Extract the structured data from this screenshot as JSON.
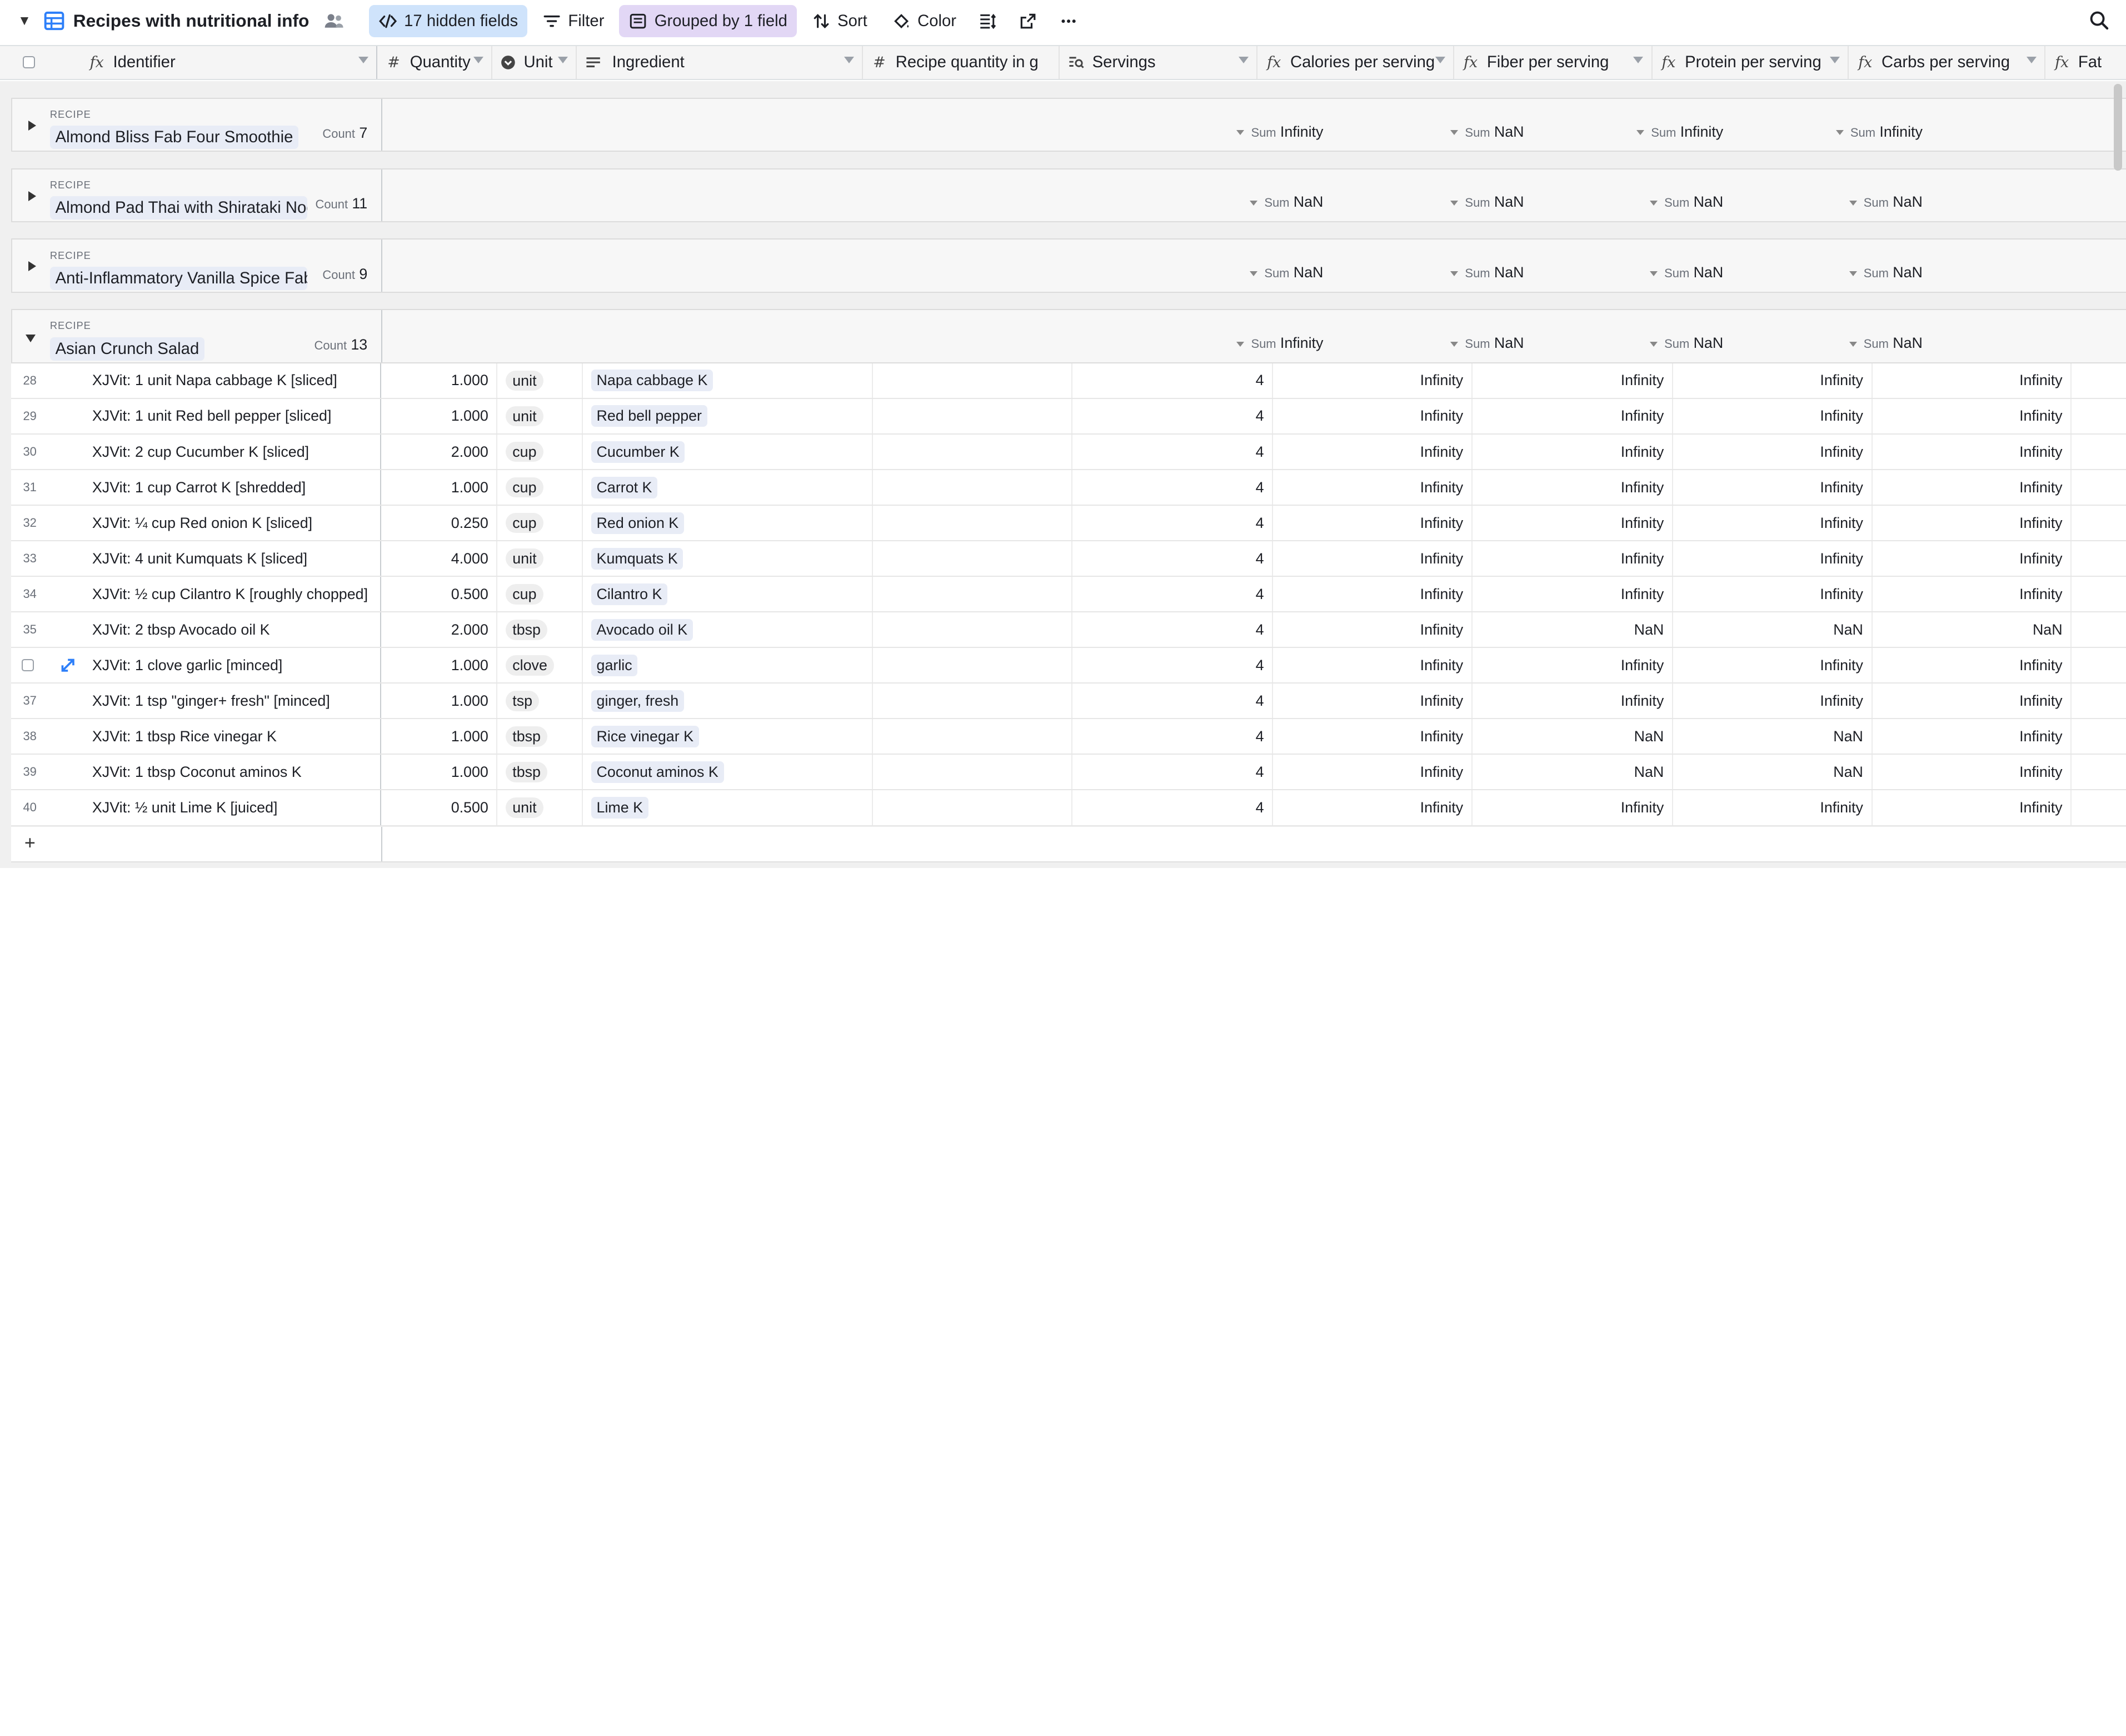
{
  "toolbar": {
    "title": "Recipes with nutritional info",
    "hidden_fields": "17 hidden fields",
    "filter": "Filter",
    "grouped": "Grouped by 1 field",
    "sort": "Sort",
    "color": "Color"
  },
  "columns": [
    {
      "label": "Identifier",
      "icon": "formula-icon"
    },
    {
      "label": "Quantity",
      "icon": "number-icon"
    },
    {
      "label": "Unit",
      "icon": "single-select-icon"
    },
    {
      "label": "Ingredient",
      "icon": "link-icon"
    },
    {
      "label": "Recipe quantity in g",
      "icon": "number-icon"
    },
    {
      "label": "Servings",
      "icon": "lookup-icon"
    },
    {
      "label": "Calories per serving",
      "icon": "formula-icon"
    },
    {
      "label": "Fiber per serving",
      "icon": "formula-icon"
    },
    {
      "label": "Protein per serving",
      "icon": "formula-icon"
    },
    {
      "label": "Carbs per serving",
      "icon": "formula-icon"
    },
    {
      "label": "Fat",
      "icon": "formula-icon"
    }
  ],
  "group_label": "RECIPE",
  "count_label": "Count",
  "sum_label": "Sum",
  "groups": [
    {
      "name": "Almond Bliss Fab Four Smoothie",
      "count": "7",
      "sums": [
        "Infinity",
        "NaN",
        "Infinity",
        "Infinity"
      ],
      "expanded": false
    },
    {
      "name": "Almond Pad Thai with Shirataki Noodles",
      "count": "11",
      "sums": [
        "NaN",
        "NaN",
        "NaN",
        "NaN"
      ],
      "expanded": false
    },
    {
      "name": "Anti-Inflammatory Vanilla Spice Fab Four Smoothie",
      "count": "9",
      "sums": [
        "NaN",
        "NaN",
        "NaN",
        "NaN"
      ],
      "expanded": false
    },
    {
      "name": "Asian Crunch Salad",
      "count": "13",
      "sums": [
        "Infinity",
        "NaN",
        "NaN",
        "NaN"
      ],
      "expanded": true
    }
  ],
  "rows": [
    {
      "num": "28",
      "identifier": "XJVit: 1 unit Napa cabbage K [sliced]",
      "quantity": "1.000",
      "unit": "unit",
      "ingredient": "Napa cabbage K",
      "servings": "4",
      "calories": "Infinity",
      "fiber": "Infinity",
      "protein": "Infinity",
      "carbs": "Infinity"
    },
    {
      "num": "29",
      "identifier": "XJVit: 1 unit Red bell pepper [sliced]",
      "quantity": "1.000",
      "unit": "unit",
      "ingredient": "Red bell pepper",
      "servings": "4",
      "calories": "Infinity",
      "fiber": "Infinity",
      "protein": "Infinity",
      "carbs": "Infinity"
    },
    {
      "num": "30",
      "identifier": "XJVit: 2 cup Cucumber K [sliced]",
      "quantity": "2.000",
      "unit": "cup",
      "ingredient": "Cucumber K",
      "servings": "4",
      "calories": "Infinity",
      "fiber": "Infinity",
      "protein": "Infinity",
      "carbs": "Infinity"
    },
    {
      "num": "31",
      "identifier": "XJVit: 1 cup Carrot K [shredded]",
      "quantity": "1.000",
      "unit": "cup",
      "ingredient": "Carrot K",
      "servings": "4",
      "calories": "Infinity",
      "fiber": "Infinity",
      "protein": "Infinity",
      "carbs": "Infinity"
    },
    {
      "num": "32",
      "identifier": "XJVit: ¼ cup Red onion K [sliced]",
      "quantity": "0.250",
      "unit": "cup",
      "ingredient": "Red onion K",
      "servings": "4",
      "calories": "Infinity",
      "fiber": "Infinity",
      "protein": "Infinity",
      "carbs": "Infinity"
    },
    {
      "num": "33",
      "identifier": "XJVit: 4 unit Kumquats K [sliced]",
      "quantity": "4.000",
      "unit": "unit",
      "ingredient": "Kumquats K",
      "servings": "4",
      "calories": "Infinity",
      "fiber": "Infinity",
      "protein": "Infinity",
      "carbs": "Infinity"
    },
    {
      "num": "34",
      "identifier": "XJVit: ½ cup Cilantro K [roughly chopped]",
      "quantity": "0.500",
      "unit": "cup",
      "ingredient": "Cilantro K",
      "servings": "4",
      "calories": "Infinity",
      "fiber": "Infinity",
      "protein": "Infinity",
      "carbs": "Infinity"
    },
    {
      "num": "35",
      "identifier": "XJVit: 2 tbsp Avocado oil K",
      "quantity": "2.000",
      "unit": "tbsp",
      "ingredient": "Avocado oil K",
      "servings": "4",
      "calories": "Infinity",
      "fiber": "NaN",
      "protein": "NaN",
      "carbs": "NaN"
    },
    {
      "num": "",
      "identifier": "XJVit: 1 clove garlic [minced]",
      "quantity": "1.000",
      "unit": "clove",
      "ingredient": "garlic",
      "servings": "4",
      "calories": "Infinity",
      "fiber": "Infinity",
      "protein": "Infinity",
      "carbs": "Infinity",
      "hover": true
    },
    {
      "num": "37",
      "identifier": "XJVit: 1 tsp \"ginger+ fresh\" [minced]",
      "quantity": "1.000",
      "unit": "tsp",
      "ingredient": "ginger, fresh",
      "servings": "4",
      "calories": "Infinity",
      "fiber": "Infinity",
      "protein": "Infinity",
      "carbs": "Infinity"
    },
    {
      "num": "38",
      "identifier": "XJVit: 1 tbsp Rice vinegar K",
      "quantity": "1.000",
      "unit": "tbsp",
      "ingredient": "Rice vinegar K",
      "servings": "4",
      "calories": "Infinity",
      "fiber": "NaN",
      "protein": "NaN",
      "carbs": "Infinity"
    },
    {
      "num": "39",
      "identifier": "XJVit: 1 tbsp Coconut aminos K",
      "quantity": "1.000",
      "unit": "tbsp",
      "ingredient": "Coconut aminos K",
      "servings": "4",
      "calories": "Infinity",
      "fiber": "NaN",
      "protein": "NaN",
      "carbs": "Infinity"
    },
    {
      "num": "40",
      "identifier": "XJVit: ½ unit Lime K [juiced]",
      "quantity": "0.500",
      "unit": "unit",
      "ingredient": "Lime K",
      "servings": "4",
      "calories": "Infinity",
      "fiber": "Infinity",
      "protein": "Infinity",
      "carbs": "Infinity"
    }
  ],
  "add_row": "+"
}
